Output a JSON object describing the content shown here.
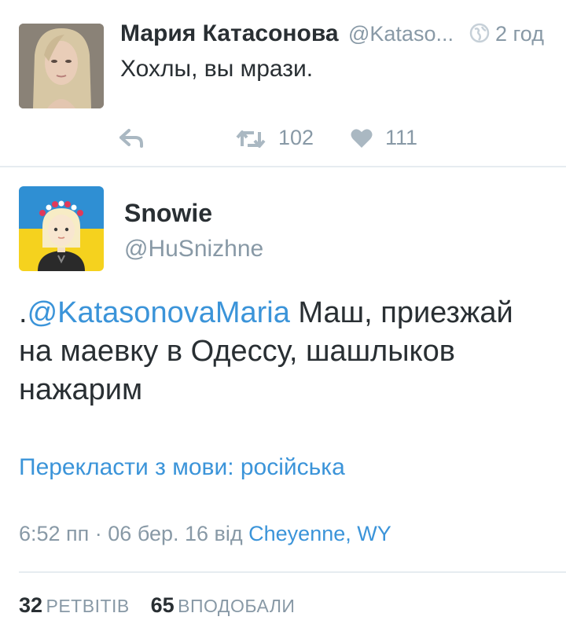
{
  "tweet1": {
    "name": "Мария Катасонова",
    "handle": "@Kataso...",
    "time": "2 год",
    "text": "Хохлы, вы мрази.",
    "retweets": "102",
    "likes": "111"
  },
  "tweet2": {
    "name": "Snowie",
    "handle": "@HuSnizhne",
    "text_prefix": ".",
    "mention": "@KatasonovaMaria",
    "text_body": " Маш, приезжай на маевку в Одессу, шашлыков нажарим",
    "translate": "Перекласти з мови: російська",
    "meta_time": "6:52 пп · 06 бер. 16 від ",
    "location": "Cheyenne, WY",
    "retweet_count": "32",
    "retweet_label": "РЕТВІТІВ",
    "like_count": "65",
    "like_label": "ВПОДОБАЛИ"
  },
  "colors": {
    "link": "#3b94d9",
    "muted": "#8899a6",
    "text": "#292f33"
  },
  "icons": [
    "globe-icon",
    "reply-icon",
    "retweet-icon",
    "heart-icon"
  ]
}
